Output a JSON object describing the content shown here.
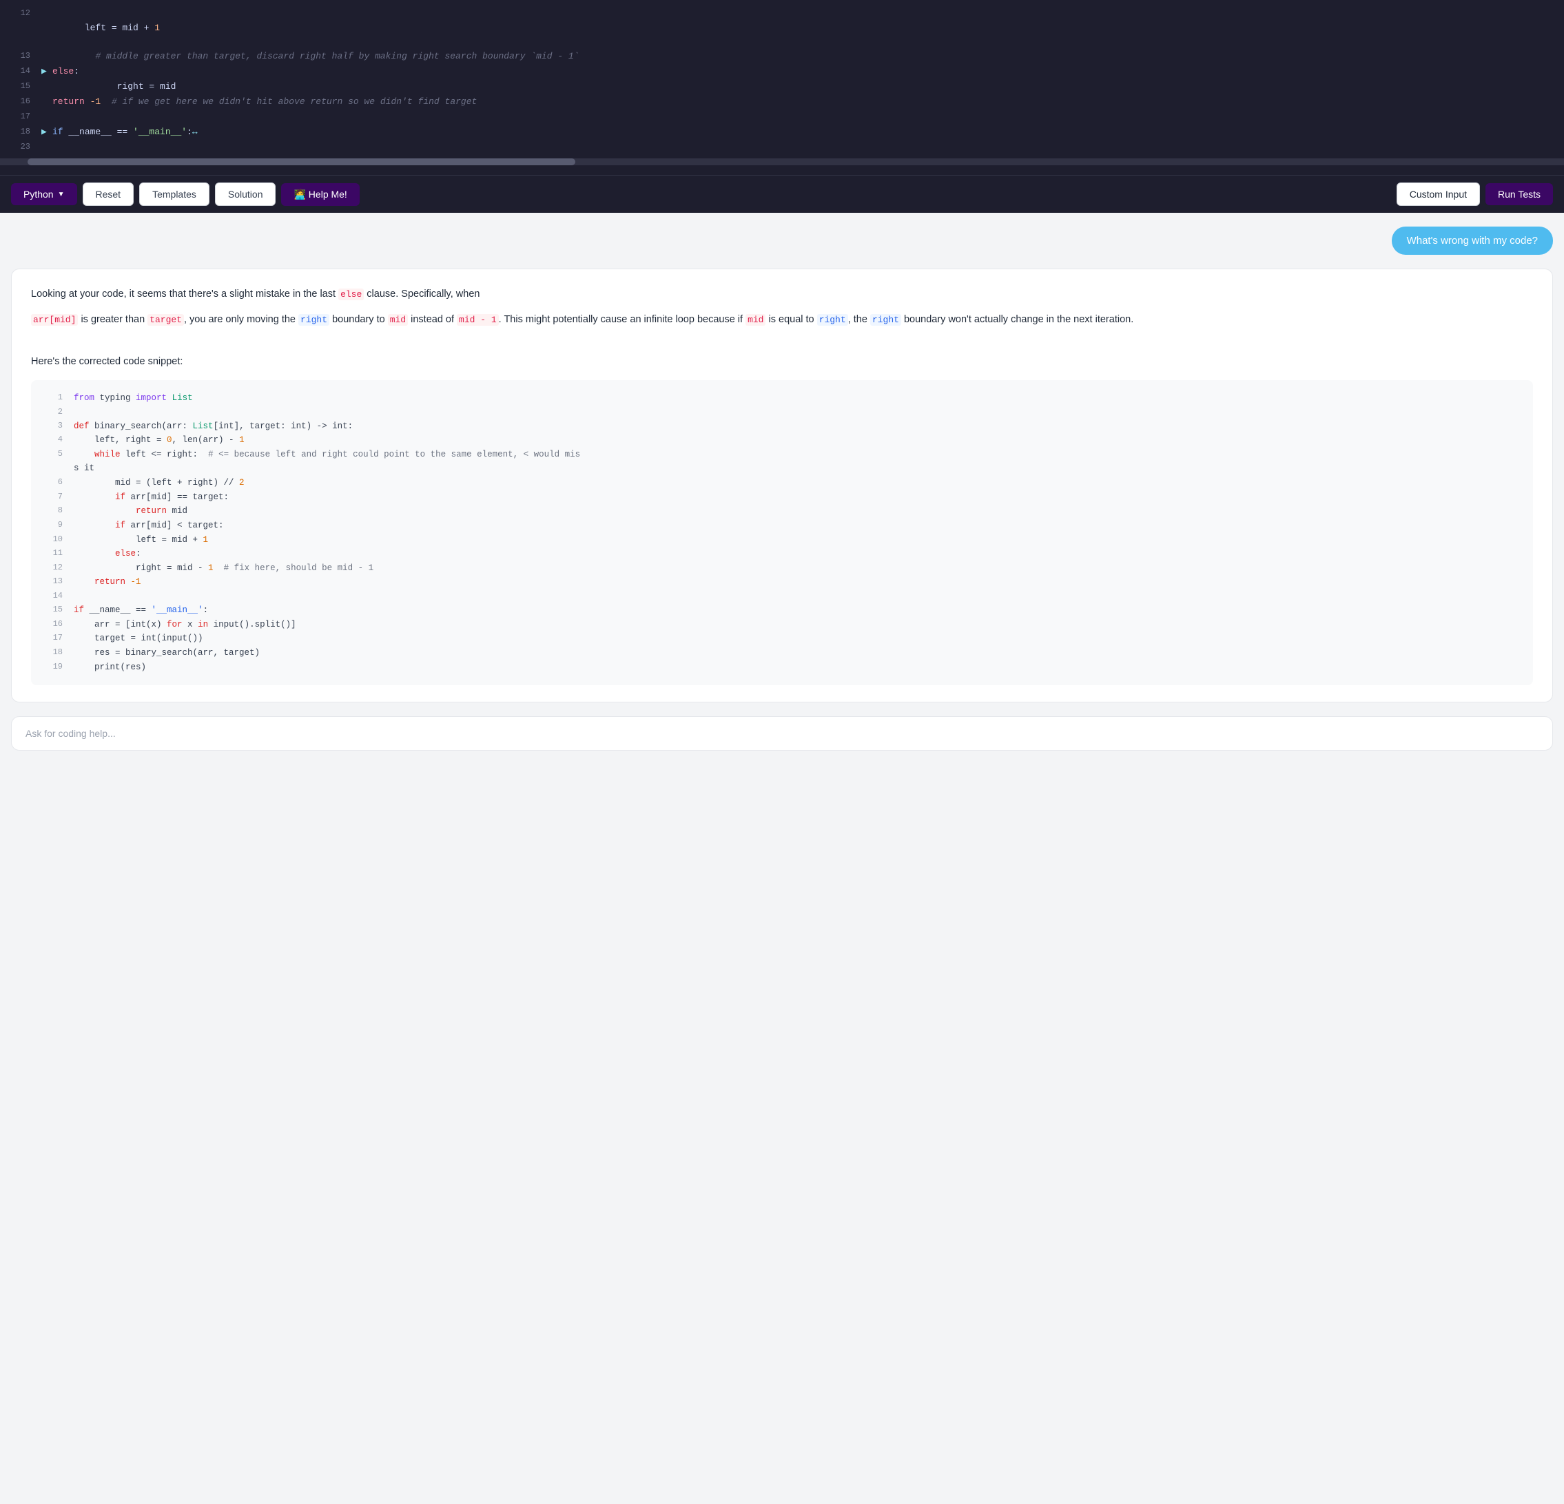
{
  "editor": {
    "lines": [
      {
        "num": 12,
        "arrow": "",
        "content": "left = mid + 1",
        "parts": [
          {
            "text": "left = mid + ",
            "class": ""
          },
          {
            "text": "1",
            "class": "kw-num"
          }
        ]
      },
      {
        "num": 13,
        "arrow": "",
        "content": "# middle greater than target, discard right half by making right search boundary `mid - 1`",
        "parts": [
          {
            "text": "# middle greater than target, discard right half by making right search boundary `mid - 1`",
            "class": "kw-comment"
          }
        ]
      },
      {
        "num": 14,
        "arrow": "▶",
        "content": "else:",
        "parts": [
          {
            "text": "else",
            "class": "kw-red"
          },
          {
            "text": ":",
            "class": ""
          }
        ]
      },
      {
        "num": 15,
        "arrow": "",
        "content": "right = mid",
        "parts": [
          {
            "text": "right = mid",
            "class": ""
          }
        ]
      },
      {
        "num": 16,
        "arrow": "",
        "content": "return -1  # if we get here we didn't hit above return so we didn't find target",
        "parts": [
          {
            "text": "return",
            "class": "kw-red"
          },
          {
            "text": " -1  ",
            "class": ""
          },
          {
            "text": "# if we get here we didn't hit above return so we didn't find target",
            "class": "kw-comment"
          }
        ]
      },
      {
        "num": 17,
        "arrow": "",
        "content": "",
        "parts": []
      },
      {
        "num": 18,
        "arrow": "▶",
        "content": "if __name__ == '__main__': ↔",
        "parts": [
          {
            "text": "if",
            "class": "kw-blue"
          },
          {
            "text": " __name__ == ",
            "class": ""
          },
          {
            "text": "'__main__'",
            "class": "kw-green"
          },
          {
            "text": ":↔",
            "class": "kw-op"
          }
        ]
      },
      {
        "num": 23,
        "arrow": "",
        "content": "",
        "parts": []
      }
    ]
  },
  "toolbar": {
    "python_label": "Python",
    "reset_label": "Reset",
    "templates_label": "Templates",
    "solution_label": "Solution",
    "help_label": "🧑‍💻 Help Me!",
    "custom_input_label": "Custom Input",
    "run_tests_label": "Run Tests"
  },
  "chat": {
    "question": "What's wrong with my code?",
    "response_p1_start": "Looking at your code, it seems that there's a slight mistake in the last ",
    "response_p1_else": "else",
    "response_p1_end": " clause. Specifically, when",
    "response_p2_arr": "arr[mid]",
    "response_p2_mid1": " is greater than ",
    "response_p2_target": "target",
    "response_p2_mid2": ", you are only moving the ",
    "response_p2_right1": "right",
    "response_p2_mid3": " boundary to ",
    "response_p2_mid4": "mid",
    "response_p2_mid5": " instead of ",
    "response_p2_mid6": "mid - 1",
    "response_p2_end": ". This might potentially cause an infinite loop because if ",
    "response_p2_mid7": "mid",
    "response_p2_end2": " is equal to ",
    "response_p2_right2": "right",
    "response_p2_end3": ", the ",
    "response_p2_right3": "right",
    "response_p2_end4": " boundary won't actually change in the next iteration.",
    "corrected_title": "Here's the corrected code snippet:",
    "code_lines": [
      {
        "num": 1,
        "content": "from typing import List"
      },
      {
        "num": 2,
        "content": ""
      },
      {
        "num": 3,
        "content": "def binary_search(arr: List[int], target: int) -> int:"
      },
      {
        "num": 4,
        "content": "    left, right = 0, len(arr) - 1"
      },
      {
        "num": 5,
        "content": "    while left <= right:  # <= because left and right could point to the same element, < would mis"
      },
      {
        "num": -1,
        "content": "s it"
      },
      {
        "num": 6,
        "content": "        mid = (left + right) // 2"
      },
      {
        "num": 7,
        "content": "        if arr[mid] == target:"
      },
      {
        "num": 8,
        "content": "            return mid"
      },
      {
        "num": 9,
        "content": "        if arr[mid] < target:"
      },
      {
        "num": 10,
        "content": "            left = mid + 1"
      },
      {
        "num": 11,
        "content": "        else:"
      },
      {
        "num": 12,
        "content": "            right = mid - 1  # fix here, should be mid - 1"
      },
      {
        "num": 13,
        "content": "    return -1"
      },
      {
        "num": 14,
        "content": ""
      },
      {
        "num": 15,
        "content": "if __name__ == '__main__':"
      },
      {
        "num": 16,
        "content": "    arr = [int(x) for x in input().split()]"
      },
      {
        "num": 17,
        "content": "    target = int(input())"
      },
      {
        "num": 18,
        "content": "    res = binary_search(arr, target)"
      },
      {
        "num": 19,
        "content": "    print(res)"
      }
    ]
  },
  "ask_placeholder": "Ask for coding help..."
}
